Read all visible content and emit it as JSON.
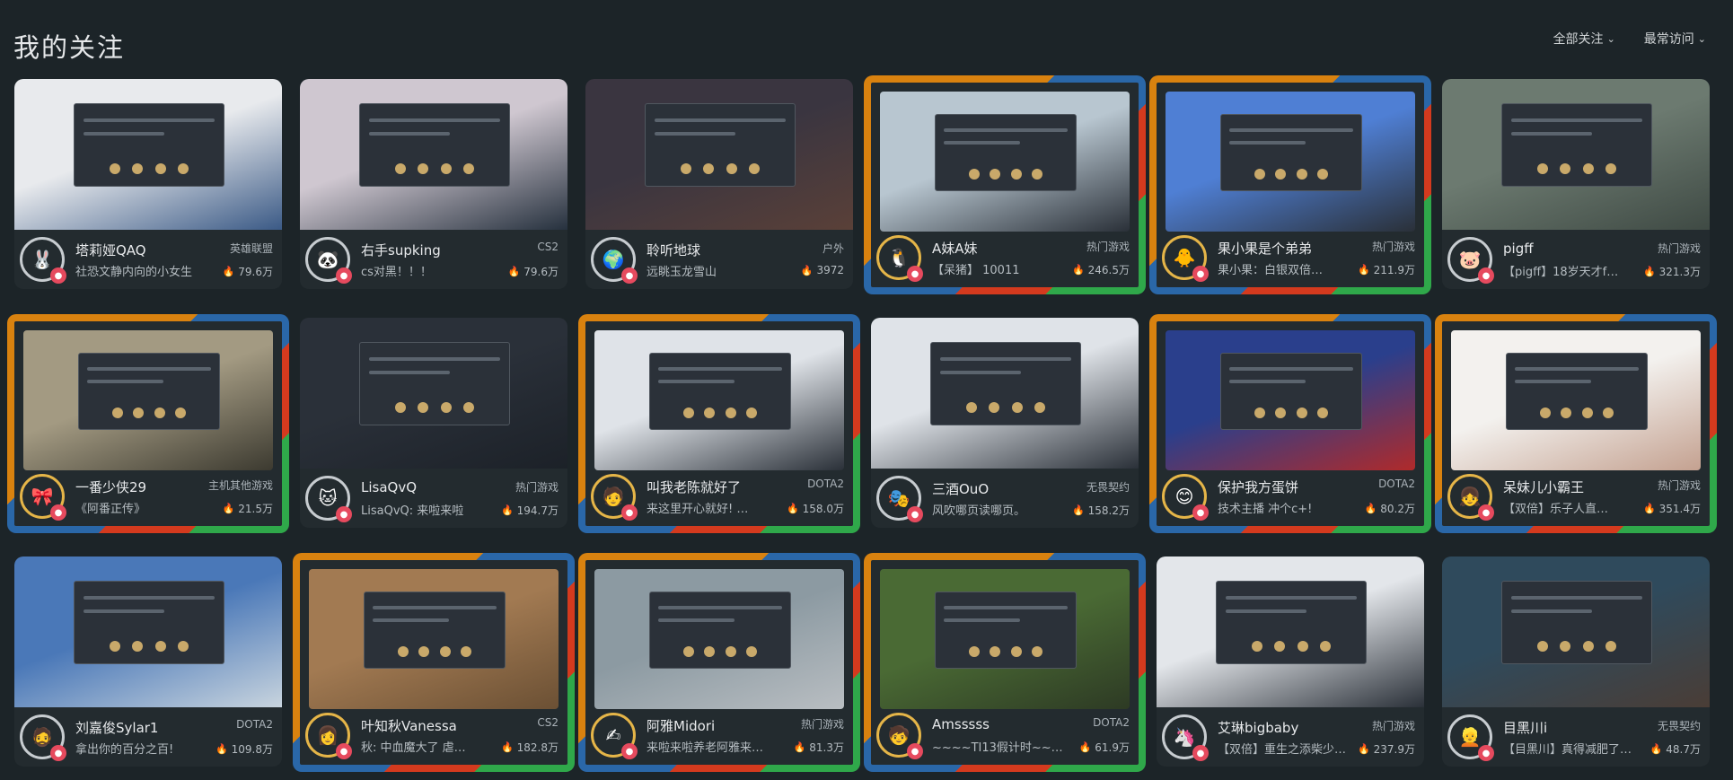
{
  "header": {
    "title": "我的关注",
    "filter_all": "全部关注",
    "filter_freq": "最常访问"
  },
  "cards": [
    {
      "name": "塔莉娅QAQ",
      "category": "英雄联盟",
      "desc": "社恐文静内向的小女生",
      "pop": "79.6万",
      "bg1": "#e8eaed",
      "bg2": "#3b5a86",
      "fancy": false,
      "avatar": "🐰"
    },
    {
      "name": "右手supking",
      "category": "CS2",
      "desc": "cs对黑！！！",
      "pop": "79.6万",
      "bg1": "#cfc7d0",
      "bg2": "#26313e",
      "fancy": false,
      "avatar": "🐼"
    },
    {
      "name": "聆听地球",
      "category": "户外",
      "desc": "远眺玉龙雪山",
      "pop": "3972",
      "bg1": "#3a3540",
      "bg2": "#5a4038",
      "fancy": false,
      "avatar": "🌍"
    },
    {
      "name": "A妹A妹",
      "category": "热门游戏",
      "desc": "【呆猪】 10011",
      "pop": "246.5万",
      "bg1": "#b8c6d0",
      "bg2": "#2a3038",
      "fancy": true,
      "avatar": "🐧"
    },
    {
      "name": "果小果是个弟弟",
      "category": "热门游戏",
      "desc": "果小果：白银双倍…",
      "pop": "211.9万",
      "bg1": "#4f7fd4",
      "bg2": "#2a3038",
      "fancy": true,
      "avatar": "🐥"
    },
    {
      "name": "pigff",
      "category": "热门游戏",
      "desc": "【pigff】18岁天才f…",
      "pop": "321.3万",
      "bg1": "#6c7a70",
      "bg2": "#3f4a44",
      "fancy": false,
      "avatar": "🐷"
    },
    {
      "name": "一番少侠29",
      "category": "主机其他游戏",
      "desc": "《阿番正传》",
      "pop": "21.5万",
      "bg1": "#a39a82",
      "bg2": "#3c3a30",
      "fancy": true,
      "avatar": "🎀"
    },
    {
      "name": "LisaQvQ",
      "category": "热门游戏",
      "desc": "LisaQvQ: 来啦来啦",
      "pop": "194.7万",
      "bg1": "#2a3039",
      "bg2": "#1c2128",
      "fancy": false,
      "avatar": "🐱"
    },
    {
      "name": "叫我老陈就好了",
      "category": "DOTA2",
      "desc": "来这里开心就好! …",
      "pop": "158.0万",
      "bg1": "#dfe3e8",
      "bg2": "#2a3038",
      "fancy": true,
      "avatar": "🧑"
    },
    {
      "name": "三酒OuO",
      "category": "无畏契约",
      "desc": "风吹哪页读哪页。",
      "pop": "158.2万",
      "bg1": "#dfe3e8",
      "bg2": "#2a3038",
      "fancy": false,
      "avatar": "🎭"
    },
    {
      "name": "保护我方蛋饼",
      "category": "DOTA2",
      "desc": "技术主播 冲个c+!",
      "pop": "80.2万",
      "bg1": "#2a3f8c",
      "bg2": "#b02a2a",
      "fancy": true,
      "avatar": "😊"
    },
    {
      "name": "呆妹儿小霸王",
      "category": "热门游戏",
      "desc": "【双倍】乐子人直…",
      "pop": "351.4万",
      "bg1": "#f3f1ee",
      "bg2": "#c4a190",
      "fancy": true,
      "avatar": "👧"
    },
    {
      "name": "刘嘉俊Sylar1",
      "category": "DOTA2",
      "desc": "拿出你的百分之百!",
      "pop": "109.8万",
      "bg1": "#4a78b8",
      "bg2": "#c8d4de",
      "fancy": false,
      "avatar": "🧔"
    },
    {
      "name": "叶知秋Vanessa",
      "category": "CS2",
      "desc": "秋: 中血魔大了 虐…",
      "pop": "182.8万",
      "bg1": "#a27a52",
      "bg2": "#6b5034",
      "fancy": true,
      "avatar": "👩"
    },
    {
      "name": "阿雅Midori",
      "category": "热门游戏",
      "desc": "来啦来啦养老阿雅来…",
      "pop": "81.3万",
      "bg1": "#8c9aa2",
      "bg2": "#b9bec2",
      "fancy": true,
      "avatar": "✍"
    },
    {
      "name": "Amsssss",
      "category": "DOTA2",
      "desc": "~~~~TI13假计时~~…",
      "pop": "61.9万",
      "bg1": "#4a6a34",
      "bg2": "#2d3a24",
      "fancy": true,
      "avatar": "🧒"
    },
    {
      "name": "艾琳bigbaby",
      "category": "热门游戏",
      "desc": "【双倍】重生之添柴少…",
      "pop": "237.9万",
      "bg1": "#e3e6ea",
      "bg2": "#2a3038",
      "fancy": false,
      "avatar": "🦄"
    },
    {
      "name": "目黑川i",
      "category": "无畏契约",
      "desc": "【目黑川】真得减肥了…",
      "pop": "48.7万",
      "bg1": "#2f4a5c",
      "bg2": "#4a3d36",
      "fancy": false,
      "avatar": "👱"
    }
  ]
}
